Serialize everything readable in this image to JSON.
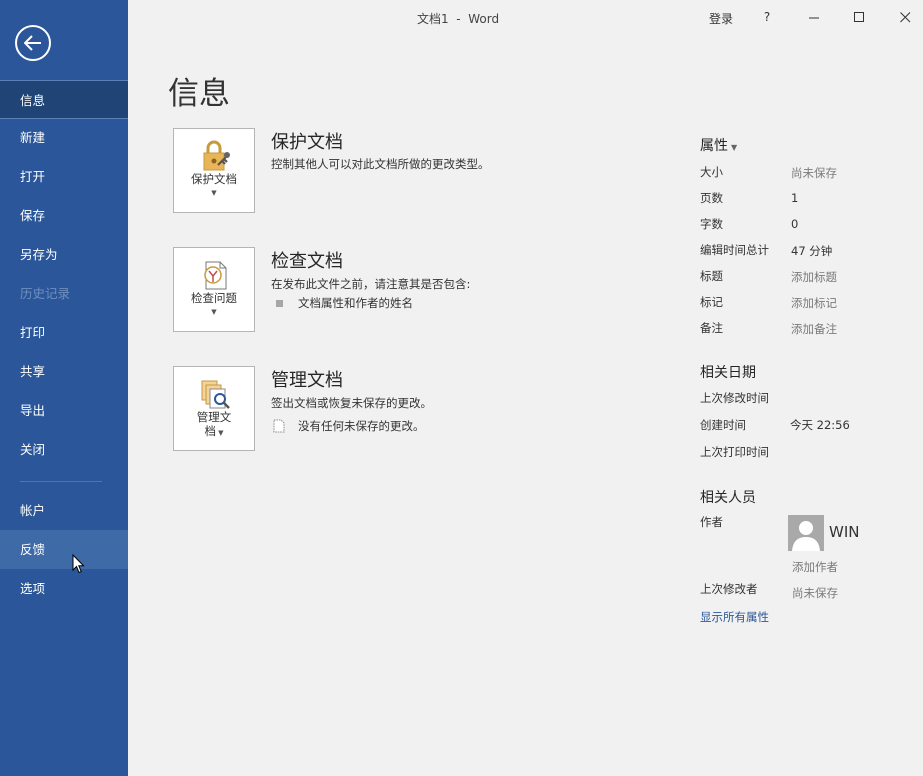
{
  "titlebar": {
    "doc_title": "文档1  -  Word",
    "login": "登录",
    "help": "?"
  },
  "sidebar": {
    "items": [
      {
        "label": "信息"
      },
      {
        "label": "新建"
      },
      {
        "label": "打开"
      },
      {
        "label": "保存"
      },
      {
        "label": "另存为"
      },
      {
        "label": "历史记录"
      },
      {
        "label": "打印"
      },
      {
        "label": "共享"
      },
      {
        "label": "导出"
      },
      {
        "label": "关闭"
      },
      {
        "label": "帐户"
      },
      {
        "label": "反馈"
      },
      {
        "label": "选项"
      }
    ]
  },
  "main": {
    "title": "信息",
    "protect": {
      "button_label": "保护文档",
      "title": "保护文档",
      "desc": "控制其他人可以对此文档所做的更改类型。"
    },
    "inspect": {
      "button_label": "检查问题",
      "title": "检查文档",
      "desc": "在发布此文件之前，请注意其是否包含:",
      "bullet": "文档属性和作者的姓名"
    },
    "manage": {
      "button_label_1": "管理文",
      "button_label_2": "档",
      "title": "管理文档",
      "desc": "签出文档或恢复未保存的更改。",
      "bullet": "没有任何未保存的更改。"
    }
  },
  "properties": {
    "heading": "属性",
    "rows": [
      {
        "key": "大小",
        "value": "尚未保存"
      },
      {
        "key": "页数",
        "value": "1"
      },
      {
        "key": "字数",
        "value": "0"
      },
      {
        "key": "编辑时间总计",
        "value": "47 分钟"
      },
      {
        "key": "标题",
        "value": "添加标题"
      },
      {
        "key": "标记",
        "value": "添加标记"
      },
      {
        "key": "备注",
        "value": "添加备注"
      }
    ],
    "dates_heading": "相关日期",
    "dates": [
      {
        "key": "上次修改时间",
        "value": ""
      },
      {
        "key": "创建时间",
        "value": "今天 22:56"
      },
      {
        "key": "上次打印时间",
        "value": ""
      }
    ],
    "people_heading": "相关人员",
    "author_key": "作者",
    "author_name": "WIN",
    "add_author": "添加作者",
    "last_modified_by_key": "上次修改者",
    "last_modified_by_value": "尚未保存",
    "show_all": "显示所有属性"
  },
  "colors": {
    "sidebar": "#2b579a",
    "accent_link": "#2b579a"
  }
}
